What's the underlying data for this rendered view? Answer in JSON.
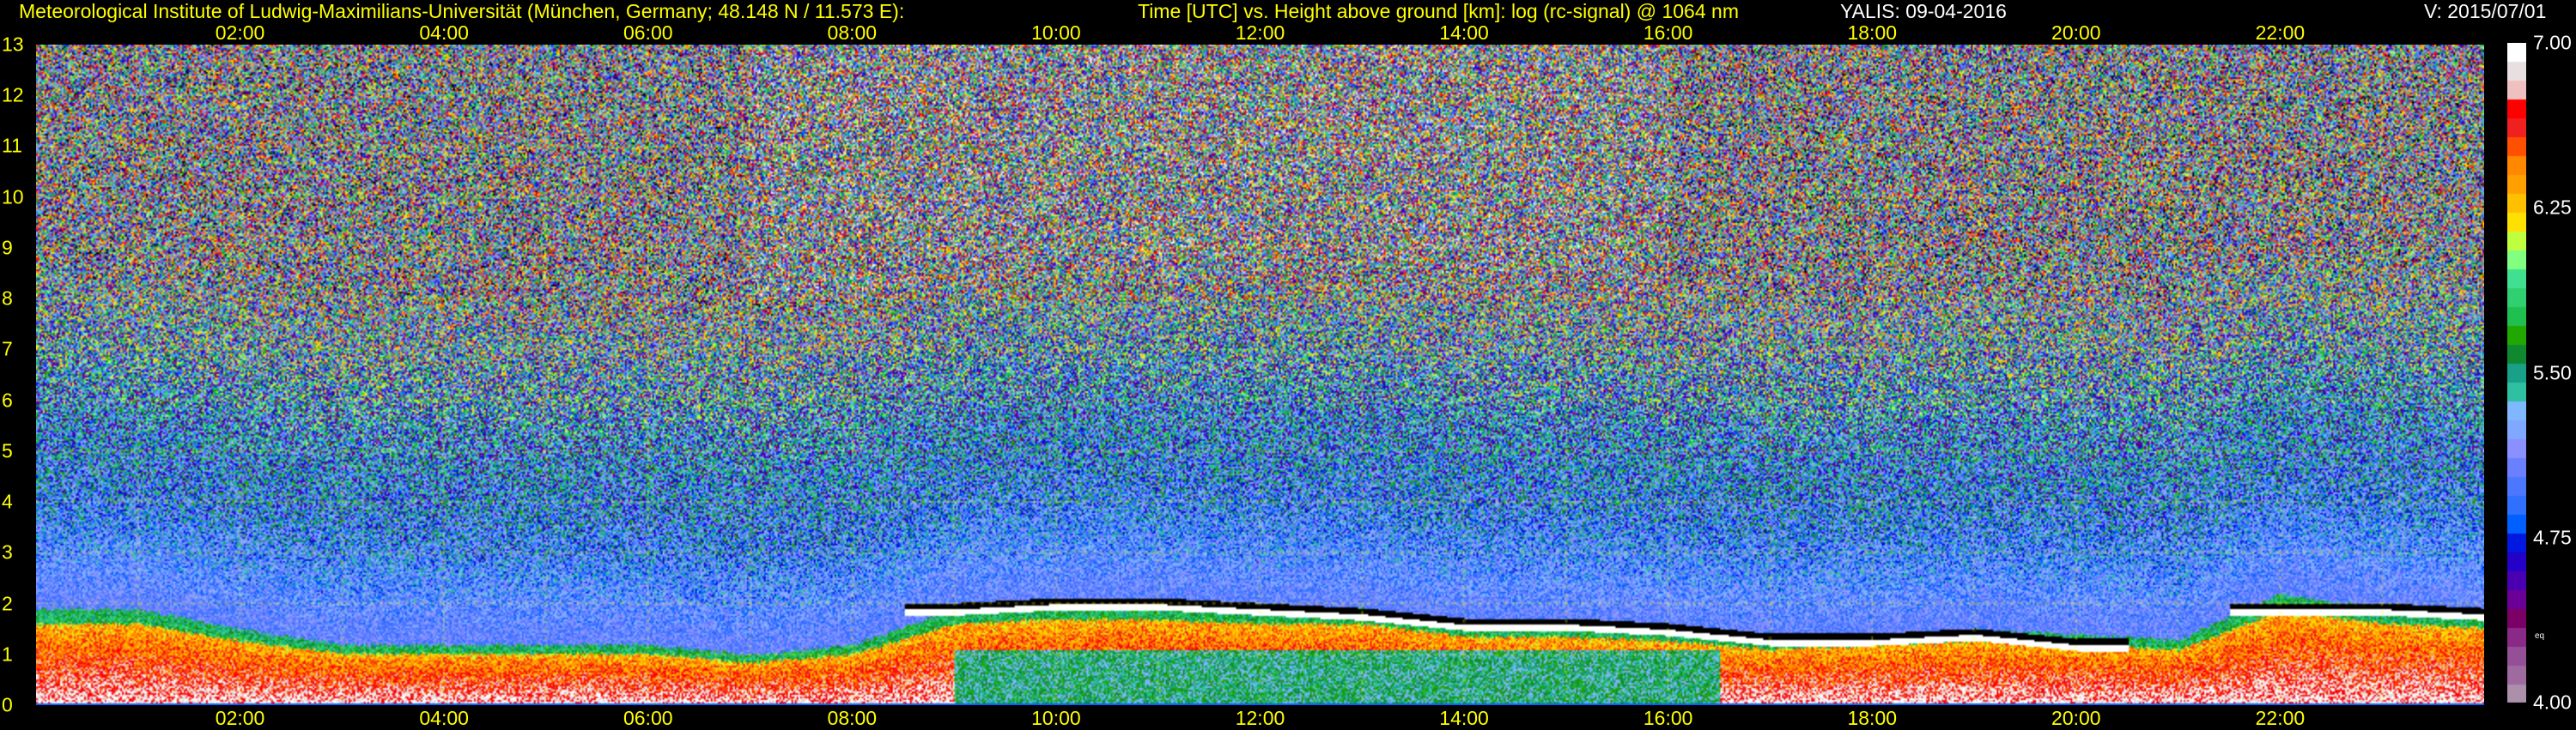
{
  "header": {
    "institute": "Meteorological Institute of Ludwig-Maximilians-Universität (München, Germany; 48.148 N / 11.573 E):",
    "axes_description": "Time [UTC] vs. Height above ground [km]: log (rc-signal) @ 1064 nm",
    "station_date": "YALIS: 09-04-2016",
    "version": "V: 2015/07/01"
  },
  "chart_data": {
    "type": "heatmap",
    "title": "Time [UTC] vs. Height above ground [km]: log (rc-signal) @ 1064 nm",
    "xlabel": "Time [UTC]",
    "ylabel": "Height above ground [km]",
    "xlim": [
      0,
      24
    ],
    "ylim": [
      0,
      13
    ],
    "x_ticks": [
      "02:00",
      "04:00",
      "06:00",
      "08:00",
      "10:00",
      "12:00",
      "14:00",
      "16:00",
      "18:00",
      "20:00",
      "22:00"
    ],
    "y_ticks": [
      "0",
      "1",
      "2",
      "3",
      "4",
      "5",
      "6",
      "7",
      "8",
      "9",
      "10",
      "11",
      "12",
      "13"
    ],
    "grid": true,
    "colorbar": {
      "range": [
        4.0,
        7.0
      ],
      "ticks": [
        "7.00",
        "6.25",
        "5.50",
        "4.75",
        "4.00"
      ],
      "unit_label": "eq",
      "colors": [
        "#ab8fab",
        "#9e6aa0",
        "#944f96",
        "#8a2a88",
        "#7a0066",
        "#6a0096",
        "#4a00b0",
        "#2400c8",
        "#0018e0",
        "#0060ff",
        "#3070ff",
        "#4c78ff",
        "#6a80ff",
        "#8a90ff",
        "#80a8ff",
        "#80b8ff",
        "#2ec0a0",
        "#18a088",
        "#108830",
        "#20a800",
        "#20c050",
        "#30d070",
        "#40e090",
        "#80ff80",
        "#c0ff40",
        "#ffe000",
        "#ffc000",
        "#ffa000",
        "#ff8800",
        "#ff5000",
        "#f02020",
        "#ff0000",
        "#f0c0c0",
        "#e8e0e0",
        "#ffffff"
      ]
    },
    "layer_top_km_by_hour": [
      1.9,
      1.9,
      1.5,
      1.2,
      1.2,
      1.2,
      1.2,
      1.0,
      1.2,
      1.9,
      2.0,
      2.0,
      1.9,
      1.9,
      1.6,
      1.6,
      1.5,
      1.3,
      1.4,
      1.5,
      1.4,
      1.3,
      2.2,
      1.9,
      1.8
    ],
    "cloud_base_km_by_hour": [
      null,
      null,
      null,
      null,
      null,
      null,
      null,
      null,
      null,
      1.9,
      2.0,
      2.0,
      1.9,
      1.8,
      1.6,
      1.6,
      1.5,
      1.3,
      1.3,
      1.4,
      1.2,
      null,
      1.9,
      1.9,
      1.8
    ]
  }
}
